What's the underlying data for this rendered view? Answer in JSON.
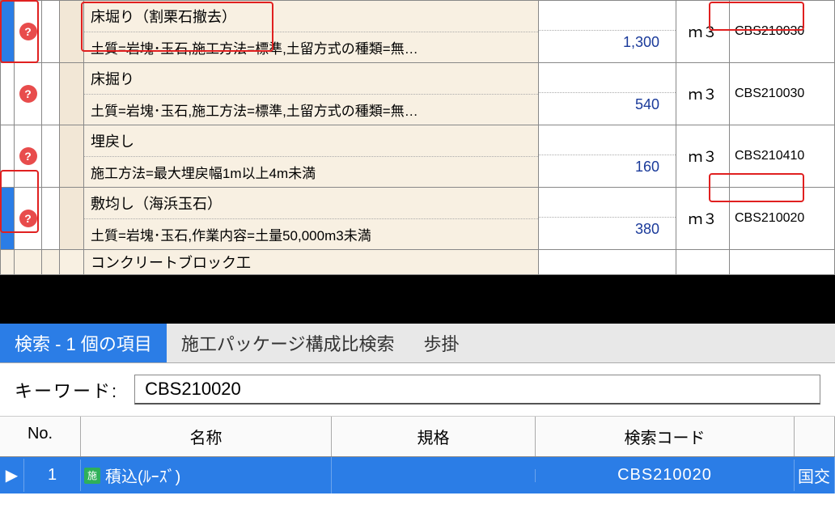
{
  "help_icon_glyph": "?",
  "rows": [
    {
      "title": "床堀り（割栗石撤去）",
      "detail": "土質=岩塊･玉石,施工方法=標準,土留方式の種類=無…",
      "qty": "1,300",
      "unit": "ｍ３",
      "code": "CBS210030",
      "highlight": true
    },
    {
      "title": "床掘り",
      "detail": "土質=岩塊･玉石,施工方法=標準,土留方式の種類=無…",
      "qty": "540",
      "unit": "ｍ３",
      "code": "CBS210030",
      "highlight": false
    },
    {
      "title": "埋戻し",
      "detail": "施工方法=最大埋戻幅1m以上4m未満",
      "qty": "160",
      "unit": "ｍ３",
      "code": "CBS210410",
      "highlight": false
    },
    {
      "title": "敷均し（海浜玉石）",
      "detail": "土質=岩塊･玉石,作業内容=土量50,000m3未満",
      "qty": "380",
      "unit": "ｍ３",
      "code": "CBS210020",
      "highlight": true
    }
  ],
  "truncated_row": "コンクリートブロック工",
  "tabs": {
    "search": "検索 - 1 個の項目",
    "pkg": "施工パッケージ構成比検索",
    "bukake": "歩掛"
  },
  "keyword_label": "キーワード:",
  "keyword_value": "CBS210020",
  "results_header": {
    "no": "No.",
    "name": "名称",
    "spec": "規格",
    "code": "検索コード"
  },
  "result": {
    "marker": "▶",
    "no": "1",
    "doc_glyph": "施",
    "name": "積込(ﾙｰｽﾞ)",
    "spec": "",
    "code": "CBS210020",
    "rest": "国交"
  }
}
